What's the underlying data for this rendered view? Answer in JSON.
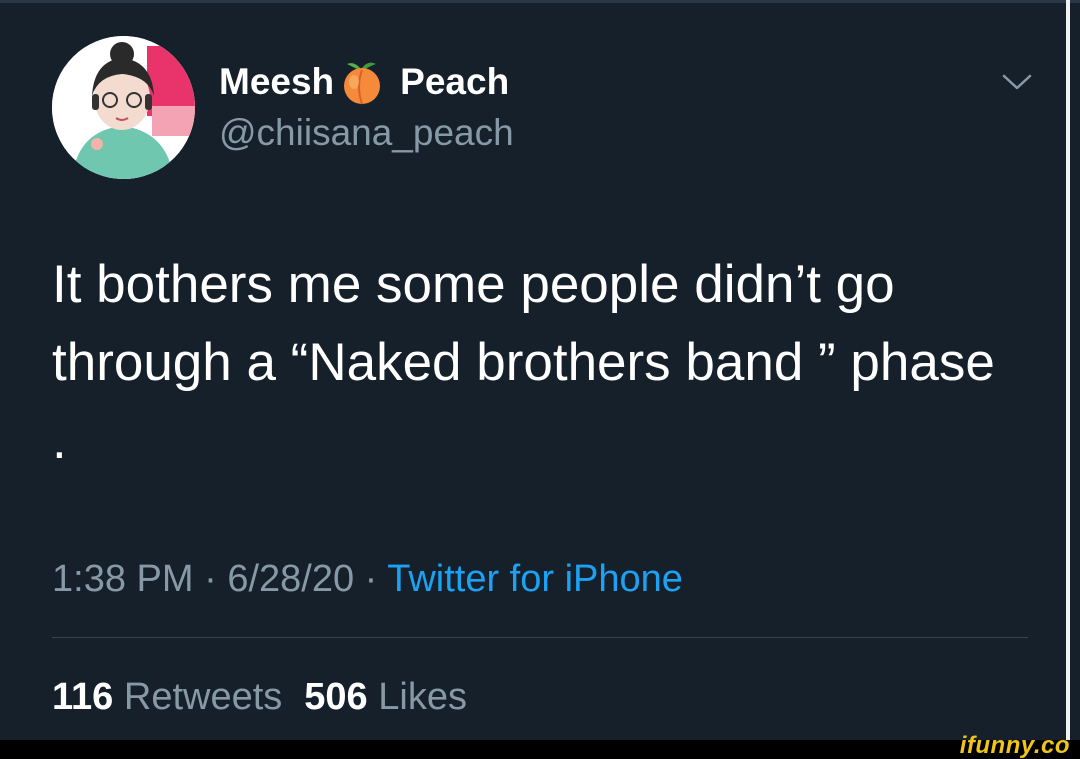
{
  "tweet": {
    "author": {
      "name_part1": "Meesh",
      "name_emoji": "peach-emoji",
      "name_part2": "Peach",
      "handle": "@chiisana_peach",
      "avatar": "avatar-image"
    },
    "menu_icon": "chevron-down-icon",
    "text": "It bothers me some people didn’t go through a “Naked brothers band ” phase .",
    "time": "1:38 PM",
    "date": "6/28/20",
    "separator": "·",
    "source": "Twitter for iPhone",
    "stats": {
      "retweets_count": "116",
      "retweets_label": "Retweets",
      "likes_count": "506",
      "likes_label": "Likes"
    }
  },
  "watermark": "ifunny.co",
  "colors": {
    "background": "#15202b",
    "secondary_text": "#8899a6",
    "link": "#1da1f2",
    "divider": "#38444d",
    "watermark": "#f0c419"
  }
}
